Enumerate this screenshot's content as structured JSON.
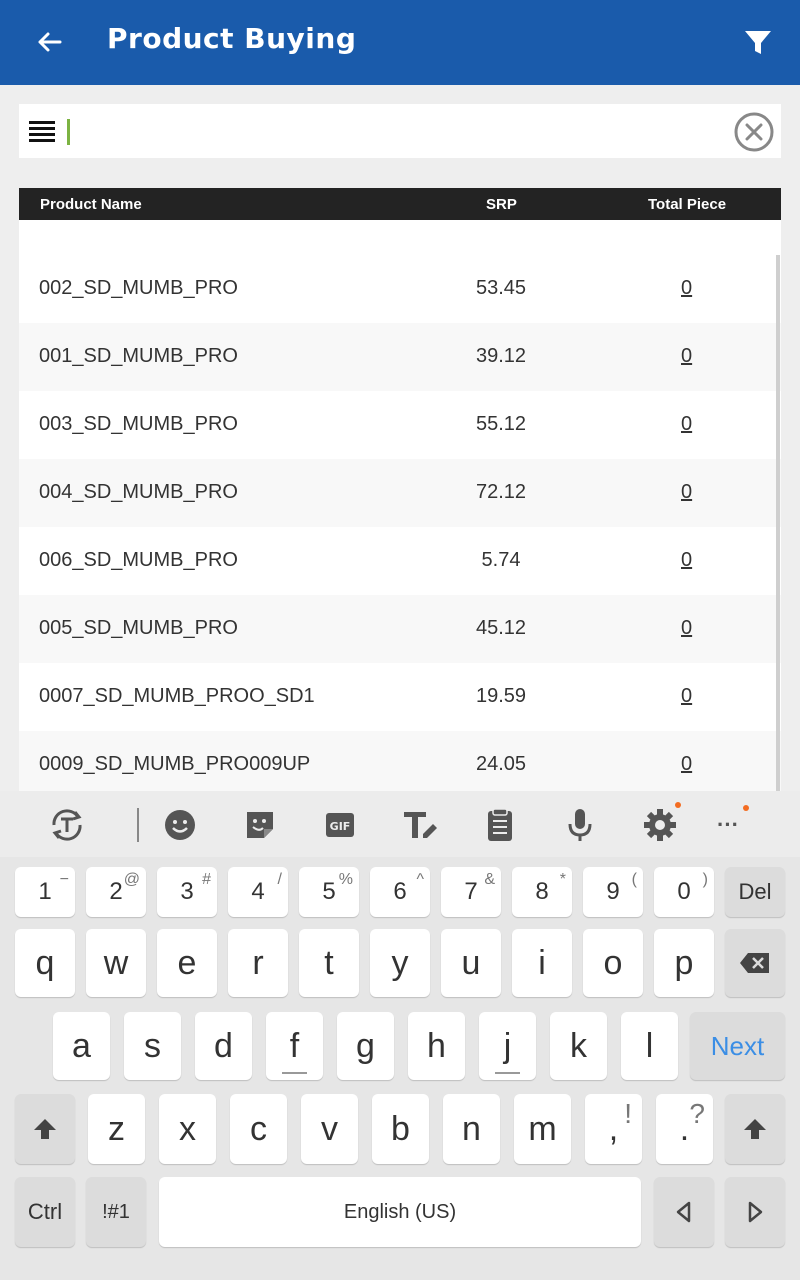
{
  "app": {
    "title": "Product Buying"
  },
  "search": {
    "value": ""
  },
  "table": {
    "headers": {
      "name": "Product Name",
      "srp": "SRP",
      "total": "Total Piece"
    },
    "rows": [
      {
        "name": "002_SD_MUMB_PRO",
        "srp": "53.45",
        "total": "0"
      },
      {
        "name": "001_SD_MUMB_PRO",
        "srp": "39.12",
        "total": "0"
      },
      {
        "name": "003_SD_MUMB_PRO",
        "srp": "55.12",
        "total": "0"
      },
      {
        "name": "004_SD_MUMB_PRO",
        "srp": "72.12",
        "total": "0"
      },
      {
        "name": "006_SD_MUMB_PRO",
        "srp": "5.74",
        "total": "0"
      },
      {
        "name": "005_SD_MUMB_PRO",
        "srp": "45.12",
        "total": "0"
      },
      {
        "name": "0007_SD_MUMB_PROO_SD1",
        "srp": "19.59",
        "total": "0"
      },
      {
        "name": "0009_SD_MUMB_PRO009UP",
        "srp": "24.05",
        "total": "0"
      }
    ]
  },
  "keyboard": {
    "toolbar_icons": [
      "translate-icon",
      "emoji-icon",
      "sticker-icon",
      "gif-icon",
      "text-edit-icon",
      "clipboard-icon",
      "mic-icon",
      "settings-icon",
      "more-icon"
    ],
    "gif_label": "GIF",
    "more_label": "···",
    "row1": [
      {
        "k": "1",
        "s": "−"
      },
      {
        "k": "2",
        "s": "@"
      },
      {
        "k": "3",
        "s": "#"
      },
      {
        "k": "4",
        "s": "/"
      },
      {
        "k": "5",
        "s": "%"
      },
      {
        "k": "6",
        "s": "^"
      },
      {
        "k": "7",
        "s": "&"
      },
      {
        "k": "8",
        "s": "*"
      },
      {
        "k": "9",
        "s": "("
      },
      {
        "k": "0",
        "s": ")"
      }
    ],
    "del": "Del",
    "row2": [
      "q",
      "w",
      "e",
      "r",
      "t",
      "y",
      "u",
      "i",
      "o",
      "p"
    ],
    "row3": [
      "a",
      "s",
      "d",
      "f",
      "g",
      "h",
      "j",
      "k",
      "l"
    ],
    "next": "Next",
    "row4": [
      "z",
      "x",
      "c",
      "v",
      "b",
      "n",
      "m"
    ],
    "comma": {
      "k": ",",
      "s": "!"
    },
    "period": {
      "k": ".",
      "s": "?"
    },
    "ctrl": "Ctrl",
    "symbols": "!#1",
    "space": "English (US)",
    "accent": "#3b8ee5",
    "header_color": "#1a5bab"
  }
}
